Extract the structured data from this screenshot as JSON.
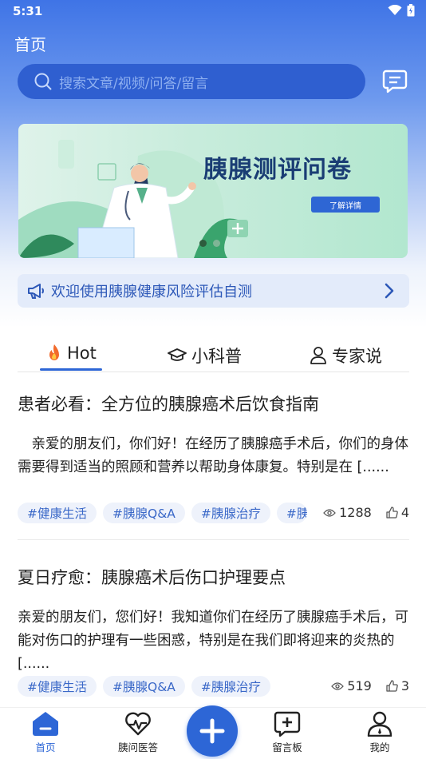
{
  "status": {
    "time": "5:31"
  },
  "header": {
    "title": "首页"
  },
  "search": {
    "placeholder": "搜索文章/视频/问答/留言"
  },
  "banner": {
    "title": "胰腺测评问卷",
    "button_label": "了解详情"
  },
  "notice": {
    "text": "欢迎使用胰腺健康风险评估自测"
  },
  "tabs": [
    {
      "label": "Hot",
      "icon": "fire-icon"
    },
    {
      "label": "小科普",
      "icon": "graduation-cap-icon"
    },
    {
      "label": "专家说",
      "icon": "user-icon"
    }
  ],
  "articles": [
    {
      "title": "患者必看：全方位的胰腺癌术后饮食指南",
      "body": "　亲爱的朋友们，你们好！在经历了胰腺癌手术后，你们的身体需要得到适当的照顾和营养以帮助身体康复。特别是在 [......",
      "tags": [
        "#健康生活",
        "#胰腺Q&A",
        "#胰腺治疗",
        "#胰"
      ],
      "views": "1288",
      "likes": "4"
    },
    {
      "title": "夏日疗愈：胰腺癌术后伤口护理要点",
      "body": "亲爱的朋友们，您们好！我知道你们在经历了胰腺癌手术后，可能对伤口的护理有一些困惑，特别是在我们即将迎来的炎热的 [......",
      "tags": [
        "#健康生活",
        "#胰腺Q&A",
        "#胰腺治疗"
      ],
      "views": "519",
      "likes": "3"
    }
  ],
  "bottom_nav": [
    {
      "label": "首页",
      "icon": "home-icon",
      "active": true
    },
    {
      "label": "胰问医答",
      "icon": "heart-pulse-icon"
    },
    {
      "label": "",
      "icon": "plus-icon"
    },
    {
      "label": "留言板",
      "icon": "message-plus-icon"
    },
    {
      "label": "我的",
      "icon": "profile-icon"
    }
  ],
  "colors": {
    "accent": "#2d66d6",
    "header_top": "#3f74e6",
    "tag_bg": "#eef2fb",
    "tag_text": "#3a68c8"
  }
}
